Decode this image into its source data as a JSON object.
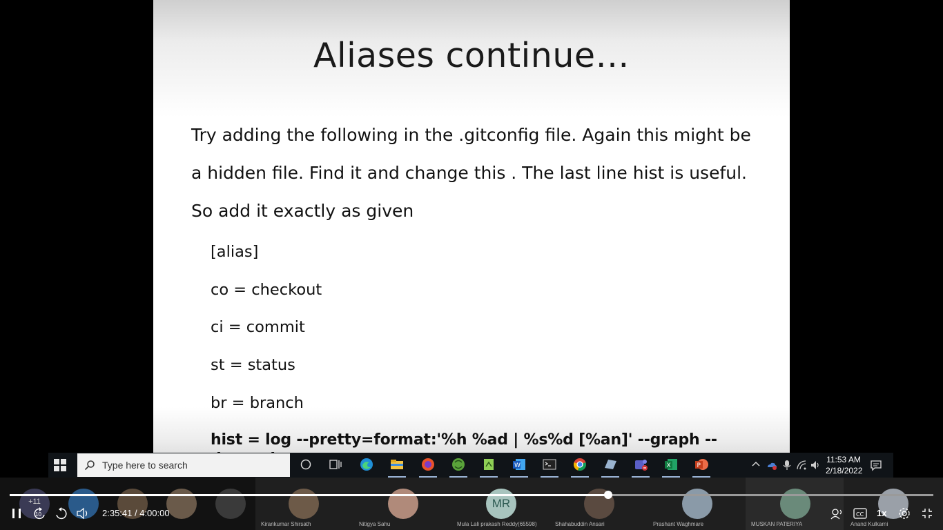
{
  "slide": {
    "title": "Aliases continue…",
    "paragraph_lines": [
      "Try adding the following in the .gitconfig file. Again this might be",
      "a hidden file. Find it and change this . The last line hist is useful.",
      "So add it exactly as given"
    ],
    "code_lines": [
      "[alias]",
      "co = checkout",
      "ci = commit",
      "st = status",
      "br = branch",
      "hist = log --pretty=format:'%h %ad | %s%d [%an]' --graph --date=short"
    ]
  },
  "taskbar": {
    "search_placeholder": "Type here to search",
    "clock_time": "11:53 AM",
    "clock_date": "2/18/2022",
    "icons": [
      "cortana-icon",
      "task-view-icon",
      "edge-icon",
      "file-explorer-icon",
      "firefox-icon",
      "eclipse-icon",
      "notepad-plus-icon",
      "word-icon",
      "terminal-icon",
      "chrome-icon",
      "app-icon",
      "teams-icon",
      "excel-icon",
      "powerpoint-icon"
    ]
  },
  "participants": {
    "overflow_label": "+11",
    "tiles": [
      {
        "name": "Kirankumar Shirsath"
      },
      {
        "name": "Nitigya Sahu"
      },
      {
        "name": "Mula Lali prakash Reddy(65598)",
        "initials": "MR"
      },
      {
        "name": "Shahabuddin Ansari"
      },
      {
        "name": "Prashant Waghmare"
      },
      {
        "name": "MUSKAN PATERIYA"
      },
      {
        "name": "Anand Kulkarni"
      }
    ]
  },
  "player": {
    "time_display": "2:35:41 / 4:00:00",
    "current": "2:35:41",
    "duration": "4:00:00",
    "progress_fraction": 0.648,
    "rewind_label": "10",
    "forward_label": "10",
    "speed_label": "1x"
  }
}
